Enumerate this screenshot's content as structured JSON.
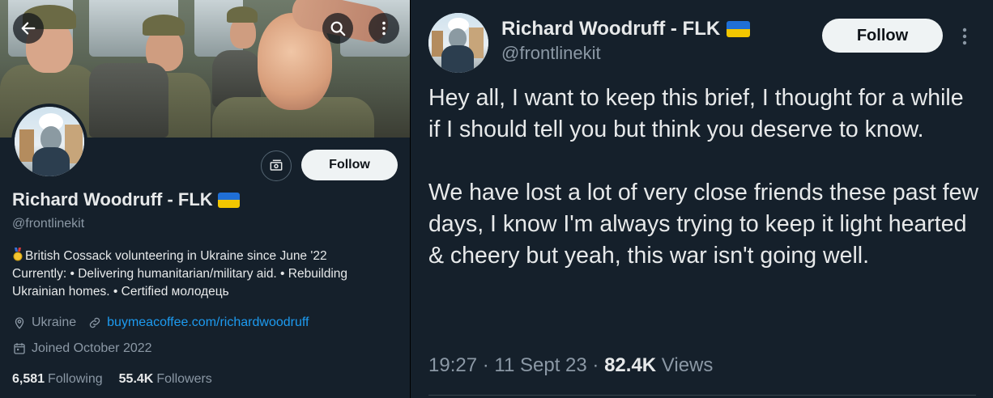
{
  "profile": {
    "banner_alt": "",
    "display_name": "Richard Woodruff - FLK",
    "handle": "@frontlinekit",
    "follow_label": "Follow",
    "bio": "British Cossack volunteering in Ukraine since June '22  Currently: • Delivering humanitarian/military aid. • Rebuilding Ukrainian homes. • Certified молодець",
    "location": "Ukraine",
    "website": "buymeacoffee.com/richardwoodruff",
    "joined": "Joined October 2022",
    "following_count": "6,581",
    "following_label": "Following",
    "followers_count": "55.4K",
    "followers_label": "Followers"
  },
  "tweet": {
    "display_name": "Richard Woodruff - FLK",
    "handle": "@frontlinekit",
    "follow_label": "Follow",
    "text": "Hey all, I want to keep this brief, I thought for a while if I should tell you but think you deserve to know.\n\nWe have lost a lot of very close friends these past few days, I know I'm always trying to keep it light hearted & cheery but yeah, this war isn't going well.",
    "time": "19:27",
    "date": "11 Sept 23",
    "views_count": "82.4K",
    "views_label": "Views"
  },
  "icons": {
    "back": "arrow-left-icon",
    "search": "search-icon",
    "more": "more-vertical-icon",
    "tip": "money-icon",
    "location": "location-pin-icon",
    "link": "link-icon",
    "calendar": "calendar-icon",
    "flag": "ukraine-flag-icon",
    "medal": "medal-icon"
  },
  "colors": {
    "background": "#15202b",
    "text_primary": "#e7e9ea",
    "text_secondary": "#8b98a5",
    "link": "#1d9bf0",
    "button_bg": "#eff3f4",
    "flag_blue": "#1f6fd6",
    "flag_yellow": "#f2c600"
  }
}
